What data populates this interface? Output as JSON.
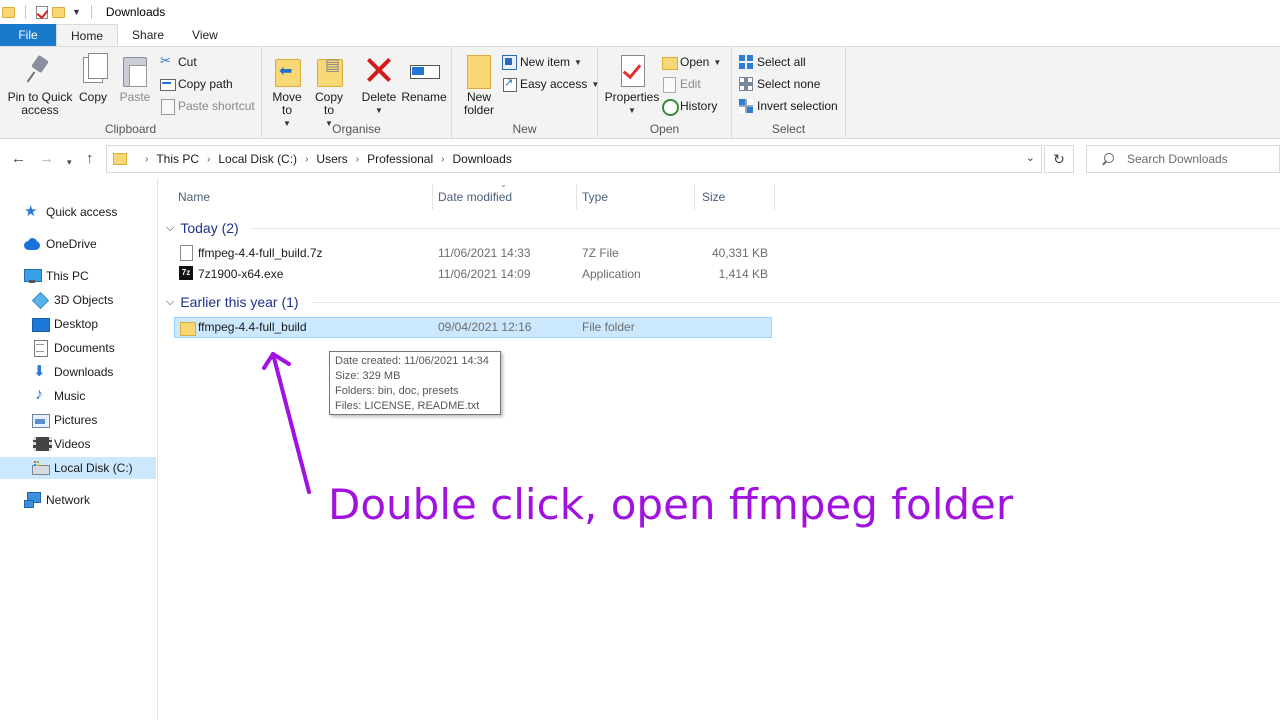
{
  "window": {
    "title": "Downloads"
  },
  "tabs": [
    {
      "label": "File"
    },
    {
      "label": "Home"
    },
    {
      "label": "Share"
    },
    {
      "label": "View"
    }
  ],
  "ribbon": {
    "clipboard": {
      "group_label": "Clipboard",
      "pin_label": "Pin to Quick access",
      "copy_label": "Copy",
      "paste_label": "Paste",
      "cut_label": "Cut",
      "copy_path_label": "Copy path",
      "paste_shortcut_label": "Paste shortcut"
    },
    "organise": {
      "group_label": "Organise",
      "move_to_label": "Move to",
      "copy_to_label": "Copy to",
      "delete_label": "Delete",
      "rename_label": "Rename"
    },
    "new": {
      "group_label": "New",
      "new_folder_label": "New folder",
      "new_item_label": "New item",
      "easy_access_label": "Easy access"
    },
    "open": {
      "group_label": "Open",
      "properties_label": "Properties",
      "open_label": "Open",
      "edit_label": "Edit",
      "history_label": "History"
    },
    "select": {
      "group_label": "Select",
      "select_all_label": "Select all",
      "select_none_label": "Select none",
      "invert_label": "Invert selection"
    }
  },
  "address": {
    "crumbs": [
      "This PC",
      "Local Disk (C:)",
      "Users",
      "Professional",
      "Downloads"
    ],
    "search_placeholder": "Search Downloads"
  },
  "sidebar": {
    "items": [
      {
        "label": "Quick access",
        "icon": "quick-access-star-icon"
      },
      {
        "label": "OneDrive",
        "icon": "onedrive-cloud-icon"
      },
      {
        "label": "This PC",
        "icon": "this-pc-icon"
      },
      {
        "label": "3D Objects",
        "icon": "3d-objects-icon"
      },
      {
        "label": "Desktop",
        "icon": "desktop-icon"
      },
      {
        "label": "Documents",
        "icon": "documents-icon"
      },
      {
        "label": "Downloads",
        "icon": "downloads-icon"
      },
      {
        "label": "Music",
        "icon": "music-icon"
      },
      {
        "label": "Pictures",
        "icon": "pictures-icon"
      },
      {
        "label": "Videos",
        "icon": "videos-icon"
      },
      {
        "label": "Local Disk (C:)",
        "icon": "local-disk-icon",
        "selected": true
      },
      {
        "label": "Network",
        "icon": "network-icon"
      }
    ]
  },
  "columns": {
    "name": "Name",
    "date": "Date modified",
    "type": "Type",
    "size": "Size"
  },
  "groups": [
    {
      "label": "Today (2)",
      "files": [
        {
          "name": "ffmpeg-4.4-full_build.7z",
          "date": "11/06/2021 14:33",
          "type": "7Z File",
          "size": "40,331 KB"
        },
        {
          "name": "7z1900-x64.exe",
          "date": "11/06/2021 14:09",
          "type": "Application",
          "size": "1,414 KB"
        }
      ]
    },
    {
      "label": "Earlier this year (1)",
      "files": [
        {
          "name": "ffmpeg-4.4-full_build",
          "date": "09/04/2021 12:16",
          "type": "File folder",
          "size": ""
        }
      ]
    }
  ],
  "tooltip": {
    "lines": [
      "Date created: 11/06/2021 14:34",
      "Size: 329 MB",
      "Folders: bin, doc, presets",
      "Files: LICENSE, README.txt"
    ]
  },
  "annotation": {
    "text": "Double click, open  ffmpeg folder",
    "color": "#a111e0"
  },
  "colors": {
    "accent": "#1979ca",
    "selection": "#cce8ff",
    "group_header": "#1e3287"
  }
}
